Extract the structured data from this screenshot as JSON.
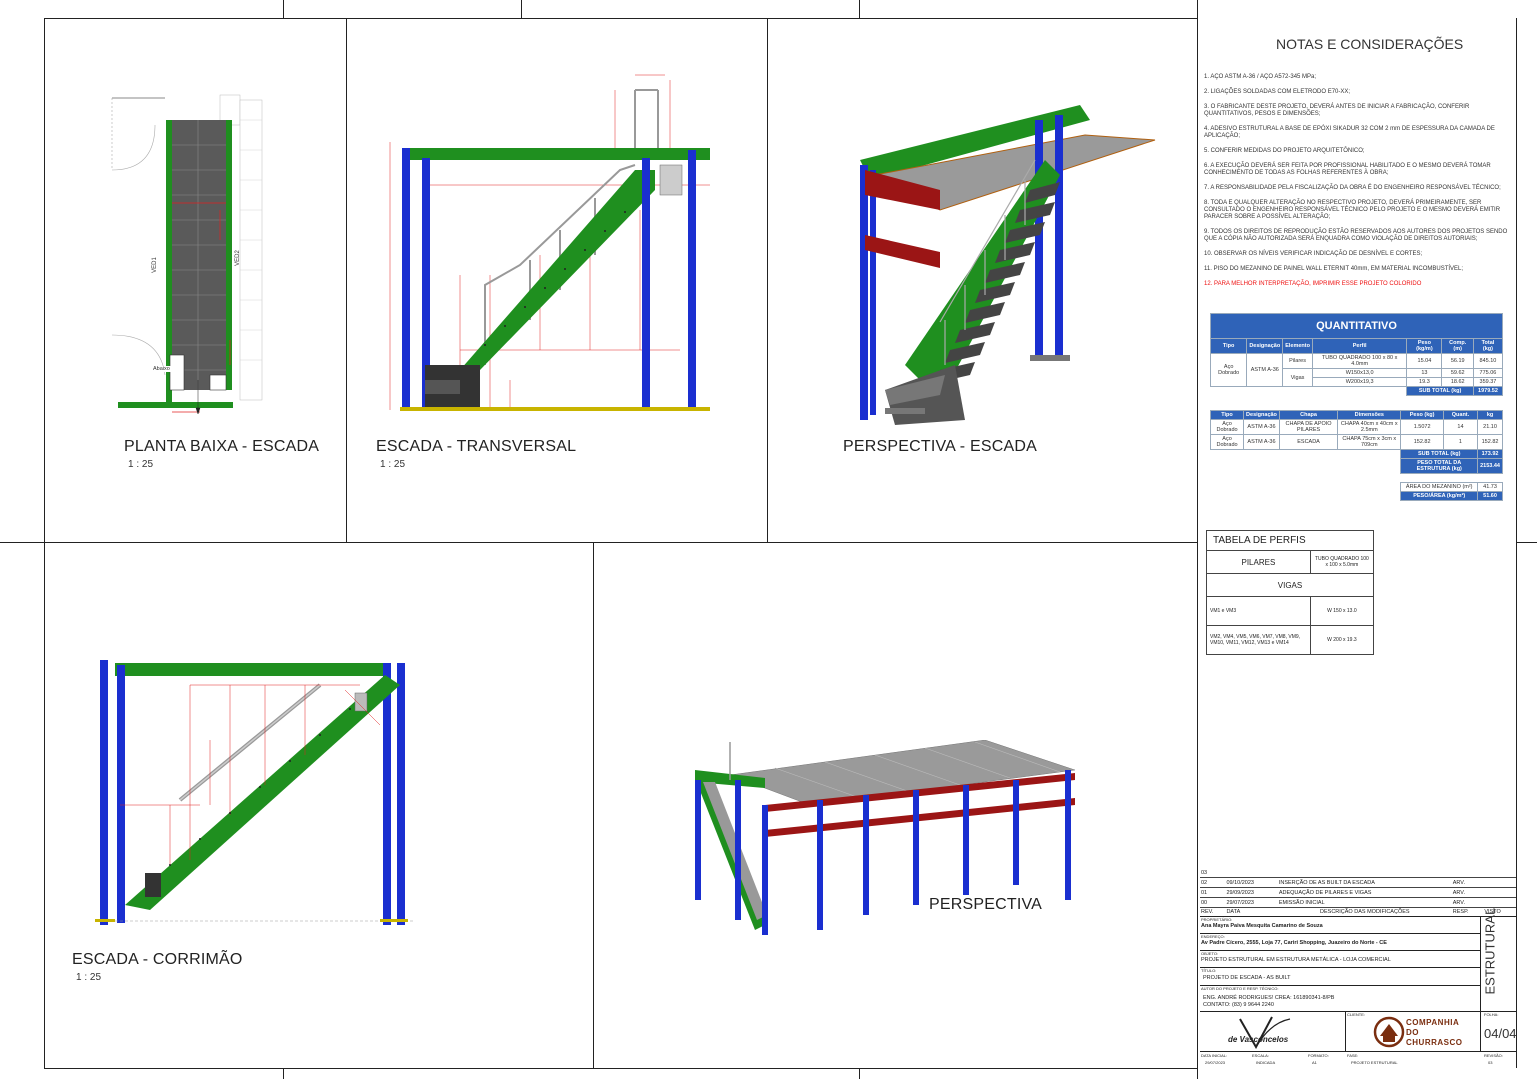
{
  "views": {
    "planta": {
      "title": "PLANTA BAIXA - ESCADA",
      "scale": "1 : 25",
      "labels": {
        "ved1": "VED1",
        "ved2": "VED2",
        "abaixo": "Abaixo"
      }
    },
    "transversal": {
      "title": "ESCADA - TRANSVERSAL",
      "scale": "1 : 25"
    },
    "perspectiva_escada": {
      "title": "PERSPECTIVA - ESCADA"
    },
    "corrimao": {
      "title": "ESCADA - CORRIMÃO",
      "scale": "1 : 25"
    },
    "perspectiva": {
      "title": "PERSPECTIVA"
    }
  },
  "notes": {
    "title": "NOTAS E CONSIDERAÇÕES",
    "items": [
      "1. AÇO ASTM A-36 / AÇO A572-345 MPa;",
      "2. LIGAÇÕES SOLDADAS COM ELETRODO E70-XX;",
      "3. O FABRICANTE DESTE PROJETO, DEVERÁ ANTES DE INICIAR A FABRICAÇÃO, CONFERIR QUANTITATIVOS, PESOS E DIMENSÕES;",
      "4. ADESIVO ESTRUTURAL A BASE DE EPÓXI SIKADUR 32 COM 2 mm DE ESPESSURA DA CAMADA DE APLICAÇÃO;",
      "5. CONFERIR MEDIDAS DO PROJETO ARQUITETÔNICO;",
      "6. A EXECUÇÃO DEVERÁ SER FEITA POR PROFISSIONAL HABILITADO E O MESMO DEVERÁ TOMAR CONHECIMENTO DE TODAS AS FOLHAS REFERENTES À OBRA;",
      "7. A RESPONSABILIDADE PELA FISCALIZAÇÃO DA OBRA É DO ENGENHEIRO RESPONSÁVEL TÉCNICO;",
      "8. TODA E QUALQUER ALTERAÇÃO NO RESPECTIVO PROJETO, DEVERÁ PRIMEIRAMENTE, SER CONSULTADO O ENGENHEIRO RESPONSÁVEL TÉCNICO PELO PROJETO E O MESMO DEVERÁ EMITIR PARACER SOBRE A POSSÍVEL ALTERAÇÃO;",
      "9. TODOS OS DIREITOS DE REPRODUÇÃO ESTÃO RESERVADOS AOS AUTORES DOS PROJETOS SENDO QUE A CÓPIA NÃO AUTORIZADA SERÁ ENQUADRA COMO VIOLAÇÃO DE DIREITOS AUTORIAIS;",
      "10. OBSERVAR OS NÍVEIS VERIFICAR INDICAÇÃO DE DESNÍVEL E CORTES;",
      "11. PISO DO MEZANINO DE PAINEL WALL ETERNIT 40mm, EM MATERIAL INCOMBUSTÍVEL;"
    ],
    "red_item": "12. PARA MELHOR INTERPRETAÇÃO, IMPRIMIR ESSE PROJETO COLORIDO"
  },
  "quantitativo": {
    "title": "QUANTITATIVO",
    "headers": [
      "Tipo",
      "Designação",
      "Elemento",
      "Perfil",
      "Peso (kg/m)",
      "Comp. (m)",
      "Total (kg)"
    ],
    "tipo": "Aço Dobrado",
    "designacao": "ASTM A-36",
    "rows": [
      {
        "elemento": "Pilares",
        "perfil": "TUBO QUADRADO 100 x 80 x 4.0mm",
        "peso": "15.04",
        "comp": "56.19",
        "total": "845.10"
      },
      {
        "elemento": "Vigas",
        "perfil": "W150x13,0",
        "peso": "13",
        "comp": "59.62",
        "total": "775.06"
      },
      {
        "elemento": "",
        "perfil": "W200x19,3",
        "peso": "19.3",
        "comp": "18.62",
        "total": "359.37"
      }
    ],
    "subtotal_label": "SUB TOTAL (kg)",
    "subtotal": "1979.52",
    "headers2": [
      "Tipo",
      "Designação",
      "Chapa",
      "Dimensões",
      "Peso (kg)",
      "Quant.",
      "kg"
    ],
    "rows2": [
      {
        "tipo": "Aço Dobrado",
        "designacao": "ASTM A-36",
        "chapa": "CHAPA DE APOIO PILARES",
        "dim": "CHAPA 40cm x 40cm x 2.5mm",
        "peso": "1.5072",
        "quant": "14",
        "kg": "21.10"
      },
      {
        "tipo": "Aço Dobrado",
        "designacao": "ASTM A-36",
        "chapa": "ESCADA",
        "dim": "CHAPA 75cm x 3cm x 709cm",
        "peso": "152.82",
        "quant": "1",
        "kg": "152.82"
      }
    ],
    "subtotal2": "173.92",
    "peso_total_label": "PESO TOTAL DA ESTRUTURA (kg)",
    "peso_total": "2153.44",
    "area_label": "ÁREA DO MEZANINO (m²)",
    "area": "41.73",
    "peso_area_label": "PESO/ÁREA (kg/m²)",
    "peso_area": "51.60"
  },
  "perfis": {
    "title": "TABELA DE PERFIS",
    "pilares_label": "PILARES",
    "pilares_val": "TUBO QUADRADO 100 x 100 x 5.0mm",
    "vigas_label": "VIGAS",
    "vigas": [
      {
        "name": "VM1 e VM3",
        "val": "W 150 x 13.0"
      },
      {
        "name": "VM2, VM4, VM5, VM6, VM7, VM8, VM9, VM10, VM11, VM12, VM13 e VM14",
        "val": "W 200 x 19.3"
      }
    ]
  },
  "titleblock": {
    "revisions": [
      {
        "rev": "03",
        "data": "",
        "desc": "",
        "resp": ""
      },
      {
        "rev": "02",
        "data": "09/10/2023",
        "desc": "INSERÇÃO DE AS BUILT DA ESCADA",
        "resp": "ARV."
      },
      {
        "rev": "01",
        "data": "29/09/2023",
        "desc": "ADEQUAÇÃO DE PILARES E VIGAS",
        "resp": "ARV."
      },
      {
        "rev": "00",
        "data": "29/07/2023",
        "desc": "EMISSÃO INICIAL",
        "resp": "ARV."
      }
    ],
    "rev_headers": [
      "REV.",
      "DATA",
      "DESCRIÇÃO DAS MODIFICAÇÕES",
      "RESP.",
      "VISTO"
    ],
    "proprietario_label": "PROPRIETÁRIO:",
    "proprietario": "Ana Mayra Paiva Mesquita Camarino de Souza",
    "endereco_label": "ENDEREÇO:",
    "endereco": "Av Padre Cícero, 2555, Loja 77, Cariri Shopping, Juazeiro do Norte - CE",
    "objeto_label": "OBJETO:",
    "objeto": "PROJETO ESTRUTURAL EM ESTRUTURA METÁLICA - LOJA COMERCIAL",
    "titulo_label": "TÍTULO:",
    "titulo": "PROJETO DE ESCADA - AS BUILT",
    "autor_label": "AUTOR DO PROJETO E RESP. TÉCNICO:",
    "autor": "ENG. ANDRÉ RODRIGUES! CREA: 161890341-8/PB",
    "contato": "CONTATO: (83) 9 9644 2240",
    "disciplina": "ESTRUTURAL",
    "cliente_label": "CLIENTE:",
    "folha_label": "FOLHA:",
    "folha": "04/04",
    "footer": [
      {
        "label": "DATA INICIAL:",
        "value": "29/07/2023"
      },
      {
        "label": "ESCALA:",
        "value": "INDICADA"
      },
      {
        "label": "FORMATO:",
        "value": "A1"
      },
      {
        "label": "FASE:",
        "value": "PROJETO ESTRUTURAL"
      },
      {
        "label": "REVISÃO:",
        "value": "03"
      }
    ],
    "logo_text": "de Vasconcelos",
    "client_logo": "COMPANHIA DO CHURRASCO"
  },
  "colors": {
    "steel_green": "#1f8f1f",
    "column_blue": "#1a2fd0",
    "beam_red": "#9b1515",
    "floor_gray": "#9a9a9a",
    "dim_red": "#e02020",
    "header_blue": "#2f63b8"
  }
}
